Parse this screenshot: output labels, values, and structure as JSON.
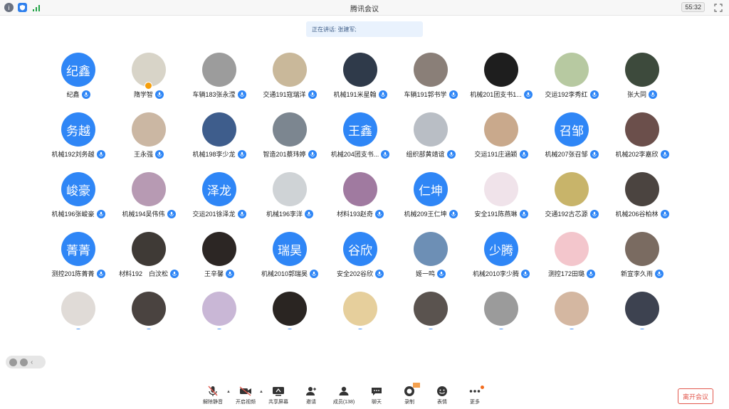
{
  "window": {
    "title": "腾讯会议",
    "timer": "55:32"
  },
  "speaking": "正在讲话: 张建军;",
  "participants": [
    {
      "name": "纪鑫",
      "avatar_text": "纪鑫"
    },
    {
      "name": "隋学智",
      "avatar_text": "",
      "color": "#d8d4c8",
      "host": true
    },
    {
      "name": "车辆183张永滢",
      "avatar_text": "",
      "color": "#9c9c9c"
    },
    {
      "name": "交通191寇瑞洋",
      "avatar_text": "",
      "color": "#c9b89a"
    },
    {
      "name": "机械191米星翰",
      "avatar_text": "",
      "color": "#2f3a4a"
    },
    {
      "name": "车辆191郭书学",
      "avatar_text": "",
      "color": "#8a7f78"
    },
    {
      "name": "机械201团支书1...",
      "avatar_text": "",
      "color": "#1e1e1e"
    },
    {
      "name": "交运192李秀红",
      "avatar_text": "",
      "color": "#b7c9a1"
    },
    {
      "name": "张大同",
      "avatar_text": "",
      "color": "#3d4a3c"
    },
    {
      "name": "机械192刘务越",
      "avatar_text": "务越"
    },
    {
      "name": "王永强",
      "avatar_text": "",
      "color": "#cbb7a3"
    },
    {
      "name": "机械198李少龙",
      "avatar_text": "",
      "color": "#3e5d8c"
    },
    {
      "name": "智造201蔡玮婷",
      "avatar_text": "",
      "color": "#7c8690"
    },
    {
      "name": "机械204团支书...",
      "avatar_text": "王鑫"
    },
    {
      "name": "组织部黄靖谊",
      "avatar_text": "",
      "color": "#b9bec5"
    },
    {
      "name": "交运191庄涵颖",
      "avatar_text": "",
      "color": "#c9a98c"
    },
    {
      "name": "机械207张召邹",
      "avatar_text": "召邹"
    },
    {
      "name": "机械202李嘉欣",
      "avatar_text": "",
      "color": "#6b4f4b"
    },
    {
      "name": "机械196张峻豪",
      "avatar_text": "峻豪"
    },
    {
      "name": "机械194吴伟伟",
      "avatar_text": "",
      "color": "#b79ab3"
    },
    {
      "name": "交运201徐泽龙",
      "avatar_text": "泽龙"
    },
    {
      "name": "机械196李洋",
      "avatar_text": "",
      "color": "#cfd3d6"
    },
    {
      "name": "材料193赵奇",
      "avatar_text": "",
      "color": "#a07aa0"
    },
    {
      "name": "机械209王仁坤",
      "avatar_text": "仁坤"
    },
    {
      "name": "安全191陈燕琳",
      "avatar_text": "",
      "color": "#f0e3ea"
    },
    {
      "name": "交通192古芯源",
      "avatar_text": "",
      "color": "#c8b46a"
    },
    {
      "name": "机械206谷柏林",
      "avatar_text": "",
      "color": "#4b4440"
    },
    {
      "name": "测控201陈菁菁",
      "avatar_text": "菁菁"
    },
    {
      "name": "材料192　白汶松",
      "avatar_text": "",
      "color": "#3f3a36"
    },
    {
      "name": "王辛馨",
      "avatar_text": "",
      "color": "#2c2624"
    },
    {
      "name": "机械2010郭瑞昊",
      "avatar_text": "瑞昊"
    },
    {
      "name": "安全202谷欣",
      "avatar_text": "谷欣"
    },
    {
      "name": "姬一鸣",
      "avatar_text": "",
      "color": "#6d8fb5"
    },
    {
      "name": "机械2010李少腾",
      "avatar_text": "少腾"
    },
    {
      "name": "测控172田璐",
      "avatar_text": "",
      "color": "#f3c6cc"
    },
    {
      "name": "新宣李久雨",
      "avatar_text": "",
      "color": "#7a6b61"
    },
    {
      "name": "",
      "avatar_text": "",
      "color": "#e0dbd7"
    },
    {
      "name": "",
      "avatar_text": "",
      "color": "#4a4340"
    },
    {
      "name": "",
      "avatar_text": "",
      "color": "#c9b7d6"
    },
    {
      "name": "",
      "avatar_text": "",
      "color": "#2a2522"
    },
    {
      "name": "",
      "avatar_text": "",
      "color": "#e6cf9c"
    },
    {
      "name": "",
      "avatar_text": "",
      "color": "#5a534f"
    },
    {
      "name": "",
      "avatar_text": "",
      "color": "#9b9b9b"
    },
    {
      "name": "",
      "avatar_text": "",
      "color": "#d4b7a1"
    },
    {
      "name": "",
      "avatar_text": "",
      "color": "#3d4250"
    }
  ],
  "toolbar": {
    "items": [
      {
        "label": "解除静音",
        "icon": "mic-muted-icon",
        "caret": true
      },
      {
        "label": "开启视频",
        "icon": "video-off-icon",
        "caret": true
      },
      {
        "label": "共享屏幕",
        "icon": "share-screen-icon"
      },
      {
        "label": "邀请",
        "icon": "invite-icon"
      },
      {
        "label": "成员(138)",
        "icon": "members-icon"
      },
      {
        "label": "聊天",
        "icon": "chat-icon"
      },
      {
        "label": "录制",
        "icon": "record-icon",
        "badge": "rec"
      },
      {
        "label": "表情",
        "icon": "emoji-icon"
      },
      {
        "label": "更多",
        "icon": "more-icon",
        "badge": "dot"
      }
    ],
    "leave_label": "离开会议"
  },
  "colors": {
    "accent": "#2f86f6",
    "leave": "#e2574c"
  }
}
